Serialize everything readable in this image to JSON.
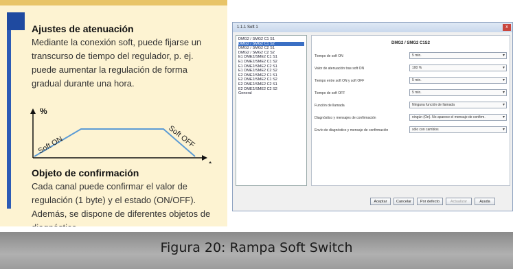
{
  "left_panel": {
    "section1": {
      "title": "Ajustes de atenuación",
      "lines": [
        "Mediante la conexión soft, puede fijarse un",
        "transcurso de tiempo del regulador, p. ej.",
        "puede aumentar la regulación de forma",
        "gradual durante una hora."
      ]
    },
    "diagram": {
      "y_label": "%",
      "x_label": "t",
      "ramp_up_label": "Soft ON",
      "ramp_down_label": "Soft OFF",
      "ramp_color": "#5b9bd5"
    },
    "section2": {
      "title": "Objeto de confirmación",
      "lines": [
        "Cada canal puede confirmar el valor de",
        "regulación (1 byte) y el estado (ON/OFF).",
        "Además, se dispone de diferentes objetos de",
        "diagnóstico."
      ]
    }
  },
  "dialog": {
    "title": "1.1.1 Soft 1",
    "close_glyph": "x",
    "list_items": [
      "DMG2 / SMG2 C1 S1",
      "DMG2 / SMG2 C1 S2",
      "DMG2 / SMG2 C2 S1",
      "DMG2 / SMG2 C2 S2",
      "E1 DME2/SME2 C1 S1",
      "E1 DME2/SME2 C1 S2",
      "E1 DME2/SME2 C2 S1",
      "E1 DME2/SME2 C2 S2",
      "E2 DME2/SME2 C1 S1",
      "E2 DME2/SME2 C1 S2",
      "E2 DME2/SME2 C2 S1",
      "E2 DME2/SME2 C2 S2",
      "General"
    ],
    "selected_index": 1,
    "form_header": "DMG2 / SMG2 C1S2",
    "rows": [
      {
        "label": "Tiempo de soft ON",
        "value": "5 min."
      },
      {
        "label": "Valor de atenuación tras soft ON",
        "value": "100 %"
      },
      {
        "label": "Tiempo entre soft ON y soft OFF",
        "value": "5 min."
      },
      {
        "label": "Tiempo de soft OFF",
        "value": "5 min."
      },
      {
        "label": "Función de llamada",
        "value": "Ninguna función de llamada"
      },
      {
        "label": "Diagnóstico y mensajes de confirmación",
        "value": "ningún (On). No aparece el mensaje de confirm."
      },
      {
        "label": "Envío de diagnóstico y mensaje de confirmación",
        "value": "sólo con cambios"
      }
    ],
    "buttons": {
      "accept": "Aceptar",
      "cancel": "Cancelar",
      "defaults": "Por defecto",
      "update": "Actualizar",
      "help": "Ayuda"
    }
  },
  "caption": {
    "text": "Figura 20: Rampa Soft Switch"
  }
}
